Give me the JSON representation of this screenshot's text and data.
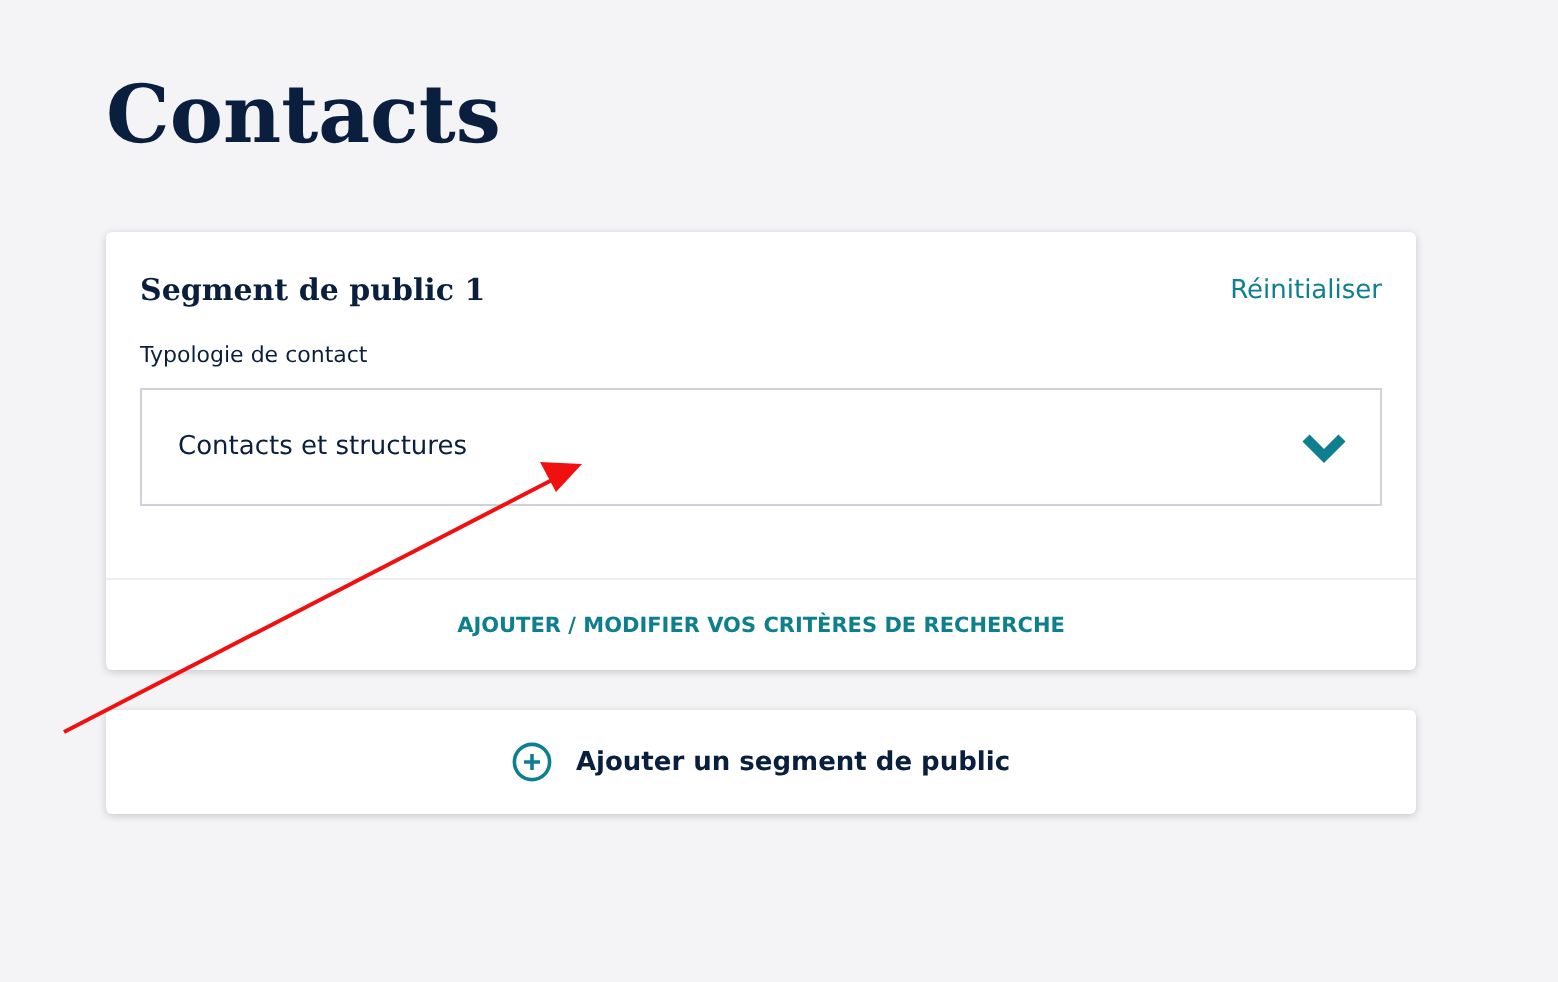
{
  "page": {
    "title": "Contacts"
  },
  "segments": [
    {
      "title": "Segment de public 1",
      "reset_link": "Réinitialiser",
      "field_label": "Typologie de contact",
      "select_value": "Contacts et structures",
      "expanded": false,
      "criteria_link": "AJOUTER / MODIFIER VOS CRITÈRES DE RECHERCHE"
    }
  ],
  "add_segment_button": "Ajouter un segment de public"
}
